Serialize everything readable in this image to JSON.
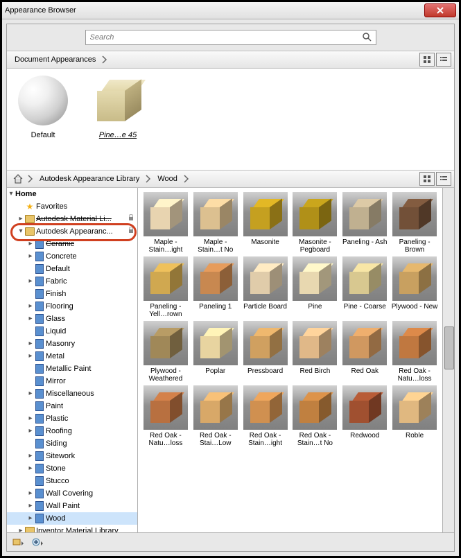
{
  "window": {
    "title": "Appearance Browser"
  },
  "search": {
    "placeholder": "Search"
  },
  "breadcrumb": {
    "root_label": "Document Appearances"
  },
  "doc": {
    "items": [
      {
        "label": "Default",
        "kind": "sphere"
      },
      {
        "label": "Pine…e  45",
        "kind": "cube",
        "color": "#d8cc9a"
      }
    ]
  },
  "libbar": {
    "items": [
      "Autodesk Appearance Library",
      "Wood"
    ]
  },
  "tree": {
    "root": "Home",
    "rows": [
      {
        "depth": 1,
        "expander": "",
        "icon": "star",
        "label": "Favorites"
      },
      {
        "depth": 1,
        "expander": "▸",
        "icon": "folder",
        "label": "Autodesk Material Li...",
        "lock": true,
        "strike": true
      },
      {
        "depth": 1,
        "expander": "▾",
        "icon": "folder",
        "label": "Autodesk Appearanc...",
        "lock": true
      },
      {
        "depth": 2,
        "expander": "▸",
        "icon": "book",
        "label": "Ceramic",
        "strike": true
      },
      {
        "depth": 2,
        "expander": "▸",
        "icon": "book",
        "label": "Concrete"
      },
      {
        "depth": 2,
        "expander": "",
        "icon": "book",
        "label": "Default"
      },
      {
        "depth": 2,
        "expander": "▸",
        "icon": "book",
        "label": "Fabric"
      },
      {
        "depth": 2,
        "expander": "",
        "icon": "book",
        "label": "Finish"
      },
      {
        "depth": 2,
        "expander": "▸",
        "icon": "book",
        "label": "Flooring"
      },
      {
        "depth": 2,
        "expander": "▸",
        "icon": "book",
        "label": "Glass"
      },
      {
        "depth": 2,
        "expander": "",
        "icon": "book",
        "label": "Liquid"
      },
      {
        "depth": 2,
        "expander": "▸",
        "icon": "book",
        "label": "Masonry"
      },
      {
        "depth": 2,
        "expander": "▸",
        "icon": "book",
        "label": "Metal"
      },
      {
        "depth": 2,
        "expander": "",
        "icon": "book",
        "label": "Metallic Paint"
      },
      {
        "depth": 2,
        "expander": "",
        "icon": "book",
        "label": "Mirror"
      },
      {
        "depth": 2,
        "expander": "▸",
        "icon": "book",
        "label": "Miscellaneous"
      },
      {
        "depth": 2,
        "expander": "",
        "icon": "book",
        "label": "Paint"
      },
      {
        "depth": 2,
        "expander": "▸",
        "icon": "book",
        "label": "Plastic"
      },
      {
        "depth": 2,
        "expander": "▸",
        "icon": "book",
        "label": "Roofing"
      },
      {
        "depth": 2,
        "expander": "",
        "icon": "book",
        "label": "Siding"
      },
      {
        "depth": 2,
        "expander": "▸",
        "icon": "book",
        "label": "Sitework"
      },
      {
        "depth": 2,
        "expander": "▸",
        "icon": "book",
        "label": "Stone"
      },
      {
        "depth": 2,
        "expander": "",
        "icon": "book",
        "label": "Stucco"
      },
      {
        "depth": 2,
        "expander": "▸",
        "icon": "book",
        "label": "Wall Covering"
      },
      {
        "depth": 2,
        "expander": "▸",
        "icon": "book",
        "label": "Wall Paint"
      },
      {
        "depth": 2,
        "expander": "▸",
        "icon": "book",
        "label": "Wood",
        "selected": true
      },
      {
        "depth": 1,
        "expander": "▸",
        "icon": "folder",
        "label": "Inventor Material Library"
      }
    ]
  },
  "gallery": {
    "items": [
      {
        "label": "Maple - Stain…ight",
        "color": "#e8d4b0"
      },
      {
        "label": "Maple - Stain…t No",
        "color": "#dcc090"
      },
      {
        "label": "Masonite",
        "color": "#c5a020"
      },
      {
        "label": "Masonite - Pegboard",
        "color": "#b09018"
      },
      {
        "label": "Paneling - Ash",
        "color": "#c0b090"
      },
      {
        "label": "Paneling - Brown",
        "color": "#725038"
      },
      {
        "label": "Paneling - Yell…rown",
        "color": "#d0a850"
      },
      {
        "label": "Paneling 1",
        "color": "#c88850"
      },
      {
        "label": "Particle Board",
        "color": "#e0ccaa"
      },
      {
        "label": "Pine",
        "color": "#e8d8b0"
      },
      {
        "label": "Pine - Coarse",
        "color": "#d8c890"
      },
      {
        "label": "Plywood - New",
        "color": "#c8a060"
      },
      {
        "label": "Plywood - Weathered",
        "color": "#a08858"
      },
      {
        "label": "Poplar",
        "color": "#e8d4a0"
      },
      {
        "label": "Pressboard",
        "color": "#d0a060"
      },
      {
        "label": "Red Birch",
        "color": "#e0b888"
      },
      {
        "label": "Red Oak",
        "color": "#d09860"
      },
      {
        "label": "Red Oak - Natu…loss",
        "color": "#c07840"
      },
      {
        "label": "Red Oak - Natu…loss",
        "color": "#b87040"
      },
      {
        "label": "Red Oak - Stai…Low",
        "color": "#d8a868"
      },
      {
        "label": "Red Oak - Stain…ight",
        "color": "#d09050"
      },
      {
        "label": "Red Oak - Stain…t No",
        "color": "#c08040"
      },
      {
        "label": "Redwood",
        "color": "#a05030"
      },
      {
        "label": "Roble",
        "color": "#e0b880"
      }
    ]
  }
}
